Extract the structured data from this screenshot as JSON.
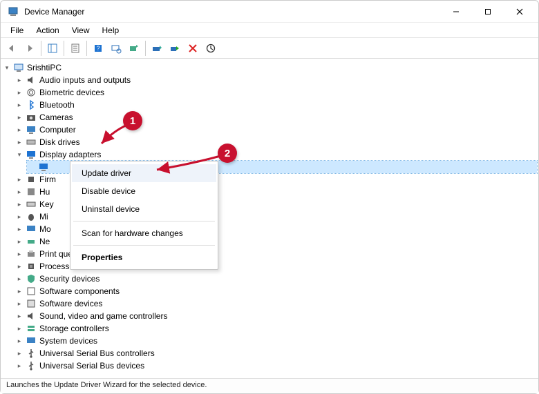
{
  "window": {
    "title": "Device Manager"
  },
  "menu": {
    "file": "File",
    "action": "Action",
    "view": "View",
    "help": "Help"
  },
  "tree": {
    "root": "SrishtiPC",
    "audio": "Audio inputs and outputs",
    "biometric": "Biometric devices",
    "bluetooth": "Bluetooth",
    "cameras": "Cameras",
    "computer": "Computer",
    "diskdrives": "Disk drives",
    "display": "Display adapters",
    "firmware": "Firm",
    "hid": "Hu",
    "keyboards": "Key",
    "mice": "Mi",
    "monitors": "Mo",
    "network": "Ne",
    "printqueues": "Print queues",
    "processors": "Processors",
    "security": "Security devices",
    "swcomp": "Software components",
    "swdev": "Software devices",
    "sound": "Sound, video and game controllers",
    "storage": "Storage controllers",
    "system": "System devices",
    "usbctrl": "Universal Serial Bus controllers",
    "usbdev": "Universal Serial Bus devices"
  },
  "context_menu": {
    "update": "Update driver",
    "disable": "Disable device",
    "uninstall": "Uninstall device",
    "scan": "Scan for hardware changes",
    "properties": "Properties"
  },
  "status": {
    "text": "Launches the Update Driver Wizard for the selected device."
  },
  "annotations": {
    "badge1": "1",
    "badge2": "2"
  }
}
